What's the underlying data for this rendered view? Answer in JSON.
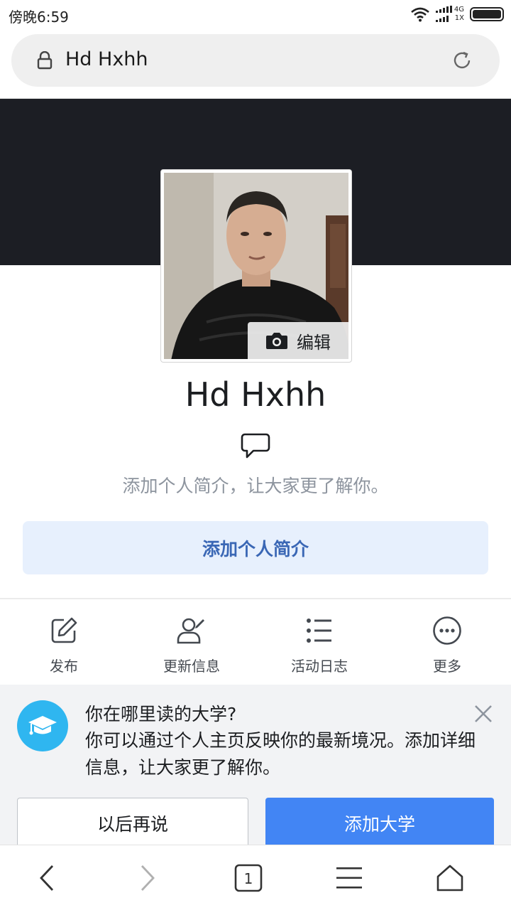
{
  "status_bar": {
    "time": "傍晚6:59",
    "network_top": "4G",
    "network_bottom": "1X"
  },
  "url_bar": {
    "title": "Hd Hxhh"
  },
  "profile": {
    "name": "Hd Hxhh",
    "edit_label": "编辑",
    "bio_prompt": "添加个人简介，让大家更了解你。",
    "add_bio_button": "添加个人简介"
  },
  "actions": [
    {
      "label": "发布",
      "icon": "edit-icon"
    },
    {
      "label": "更新信息",
      "icon": "person-edit-icon"
    },
    {
      "label": "活动日志",
      "icon": "list-icon"
    },
    {
      "label": "更多",
      "icon": "more-icon"
    }
  ],
  "suggestion": {
    "title": "你在哪里读的大学?",
    "body": "你可以通过个人主页反映你的最新境况。添加详细信息，让大家更了解你。",
    "later_button": "以后再说",
    "add_button": "添加大学"
  },
  "bottom_nav": {
    "tab_count": "1"
  },
  "colors": {
    "accent": "#4285f4",
    "cover": "#1c1e24",
    "bio_button_bg": "#e7f0fd",
    "bio_button_text": "#3a67b5",
    "school_icon_bg": "#2fb6f0"
  }
}
